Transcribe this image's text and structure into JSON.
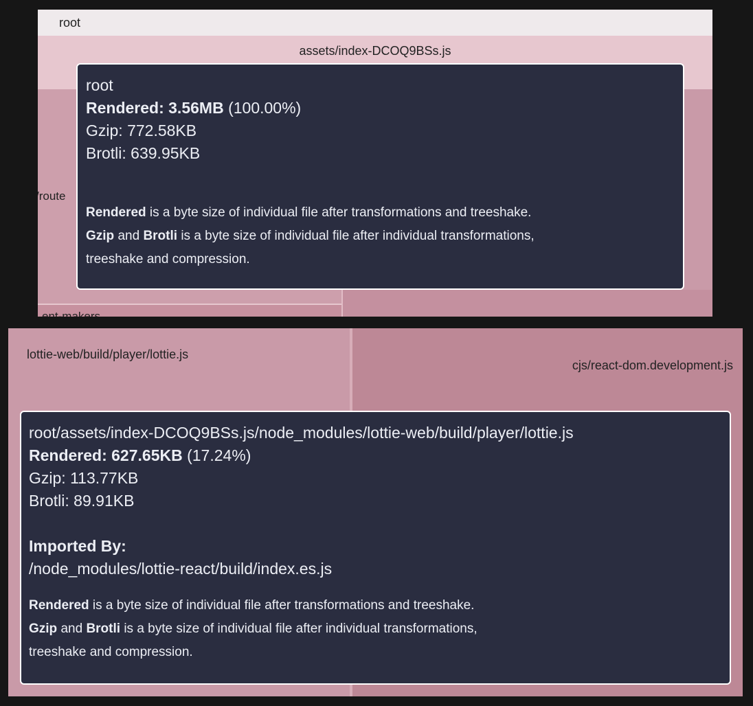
{
  "top_view": {
    "root_label": "root",
    "asset_label": "assets/index-DCOQ9BSs.js",
    "router_label": "/route",
    "foot_label": "ent-makers"
  },
  "bottom_view": {
    "left_label": "lottie-web/build/player/lottie.js",
    "right_label": "cjs/react-dom.development.js"
  },
  "tooltip_top": {
    "path": "root",
    "rendered_label": "Rendered:",
    "rendered_size": "3.56MB",
    "rendered_pct": "(100.00%)",
    "gzip": "Gzip: 772.58KB",
    "brotli": "Brotli: 639.95KB"
  },
  "tooltip_bottom": {
    "path": "root/assets/index-DCOQ9BSs.js/node_modules/lottie-web/build/player/lottie.js",
    "rendered_label": "Rendered:",
    "rendered_size": "627.65KB",
    "rendered_pct": "(17.24%)",
    "gzip": "Gzip: 113.77KB",
    "brotli": "Brotli: 89.91KB",
    "imported_by_label": "Imported By:",
    "imported_by": "/node_modules/lottie-react/build/index.es.js"
  },
  "notes": {
    "rendered_word": "Rendered",
    "rendered_desc": "is a byte size of individual file after transformations and treeshake.",
    "gzip_word": "Gzip",
    "and_word": "and",
    "brotli_word": "Brotli",
    "compressed_desc": "is a byte size of individual file after individual transformations,",
    "compressed_desc_2": "treeshake and compression."
  }
}
